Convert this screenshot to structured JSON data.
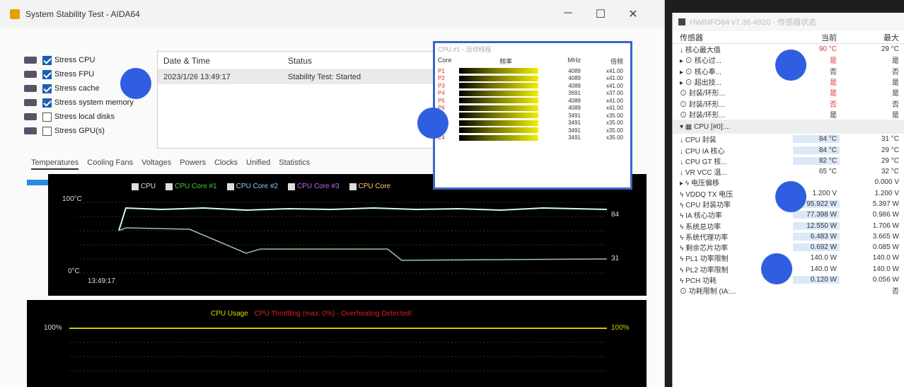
{
  "aida": {
    "title": "System Stability Test - AIDA64",
    "controls": {
      "minimize": "─",
      "maximize": "☐",
      "close": "✕"
    },
    "stress_options": [
      {
        "label": "Stress CPU",
        "checked": true
      },
      {
        "label": "Stress FPU",
        "checked": true
      },
      {
        "label": "Stress cache",
        "checked": true
      },
      {
        "label": "Stress system memory",
        "checked": true
      },
      {
        "label": "Stress local disks",
        "checked": false
      },
      {
        "label": "Stress GPU(s)",
        "checked": false
      }
    ],
    "status_table": {
      "col_date": "Date & Time",
      "col_status": "Status",
      "row_date": "2023/1/26 13:49:17",
      "row_status": "Stability Test: Started"
    },
    "tabs": [
      "Temperatures",
      "Cooling Fans",
      "Voltages",
      "Powers",
      "Clocks",
      "Unified",
      "Statistics"
    ],
    "temp_graph": {
      "legend": [
        "CPU",
        "CPU Core #1",
        "CPU Core #2",
        "CPU Core #3",
        "CPU Core"
      ],
      "y_top": "100°C",
      "y_bottom": "0°C",
      "x_start": "13:49:17",
      "right_top": "84",
      "right_bottom": "31"
    },
    "usage_graph": {
      "title": "CPU Usage",
      "subtitle": "CPU Throttling (max: 0%) - Overheating Detected!",
      "y_top": "100%",
      "right_top": "100%"
    },
    "cpu_overlay": {
      "title": "CPU #1 - 活动线程",
      "col_core": "Core",
      "col_clock": "频率",
      "col_mhz": "MHz",
      "col_mult": "倍频",
      "rows": [
        {
          "core": "P1",
          "mhz": "4089",
          "mult": "x41.00"
        },
        {
          "core": "P2",
          "mhz": "4089",
          "mult": "x41.00"
        },
        {
          "core": "P3",
          "mhz": "4089",
          "mult": "x41.00"
        },
        {
          "core": "P4",
          "mhz": "3691",
          "mult": "x37.00"
        },
        {
          "core": "P5",
          "mhz": "4089",
          "mult": "x41.00"
        },
        {
          "core": "P6",
          "mhz": "4089",
          "mult": "x41.00"
        },
        {
          "core": "E1",
          "mhz": "3491",
          "mult": "x35.00"
        },
        {
          "core": "E2",
          "mhz": "3491",
          "mult": "x35.00"
        },
        {
          "core": "E3",
          "mhz": "3491",
          "mult": "x35.00"
        },
        {
          "core": "E4",
          "mhz": "3491",
          "mult": "x35.00"
        }
      ]
    }
  },
  "hwinfo": {
    "title": "HWiNFO64 v7.36-4920 - 传感器状态",
    "col_sensor": "传感器",
    "col_current": "当前",
    "col_max": "最大",
    "rows": [
      {
        "label": "↓ 核心最大值",
        "cur": "90 °C",
        "mx": "29 °C",
        "style": "red"
      },
      {
        "label": "▸ ⊙ 核心过...",
        "cur": "是",
        "mx": "是",
        "style": "red"
      },
      {
        "label": "▸ ⊙ 核心奉...",
        "cur": "否",
        "mx": "否",
        "style": ""
      },
      {
        "label": "▸ ⊙ 超出技...",
        "cur": "是",
        "mx": "是",
        "style": "red"
      },
      {
        "label": "⊙ 封装/环形...",
        "cur": "是",
        "mx": "是",
        "style": "red"
      },
      {
        "label": "⊙ 封装/环形...",
        "cur": "否",
        "mx": "否",
        "style": "red"
      },
      {
        "label": "⊙ 封装/环形...",
        "cur": "是",
        "mx": "是",
        "style": ""
      }
    ],
    "section": "▾ ▦ CPU [#0]:...",
    "rows2": [
      {
        "label": "↓ CPU 封装",
        "cur": "84 °C",
        "mx": "31 °C",
        "style": "hl"
      },
      {
        "label": "↓ CPU IA 核心",
        "cur": "84 °C",
        "mx": "29 °C",
        "style": "hl"
      },
      {
        "label": "↓ CPU GT 核...",
        "cur": "82 °C",
        "mx": "29 °C",
        "style": "hl"
      },
      {
        "label": "↓ VR VCC 温...",
        "cur": "65 °C",
        "mx": "32 °C",
        "style": ""
      },
      {
        "label": "▸ ϟ 电压偏移",
        "cur": "",
        "mx": "0.000 V",
        "style": ""
      },
      {
        "label": "ϟ VDDQ TX 电压",
        "cur": "1.200 V",
        "mx": "1.200 V",
        "style": ""
      },
      {
        "label": "ϟ CPU 封装功率",
        "cur": "95.922 W",
        "mx": "5.397 W",
        "style": "hl"
      },
      {
        "label": "ϟ IA 核心功率",
        "cur": "77.398 W",
        "mx": "0.986 W",
        "style": "hl"
      },
      {
        "label": "ϟ 系统总功率",
        "cur": "12.550 W",
        "mx": "1.706 W",
        "style": "hl"
      },
      {
        "label": "ϟ 系统代理功率",
        "cur": "6.483 W",
        "mx": "3.665 W",
        "style": "hl"
      },
      {
        "label": "ϟ 剩余芯片功率",
        "cur": "0.692 W",
        "mx": "0.085 W",
        "style": "hl"
      },
      {
        "label": "ϟ PL1 功率限制",
        "cur": "140.0 W",
        "mx": "140.0 W",
        "style": ""
      },
      {
        "label": "ϟ PL2 功率限制",
        "cur": "140.0 W",
        "mx": "140.0 W",
        "style": ""
      },
      {
        "label": "ϟ PCH 功耗",
        "cur": "0.120 W",
        "mx": "0.056 W",
        "style": "hl"
      },
      {
        "label": "⊙ 功耗限制 (IA:...",
        "cur": "",
        "mx": "否",
        "style": ""
      }
    ]
  }
}
